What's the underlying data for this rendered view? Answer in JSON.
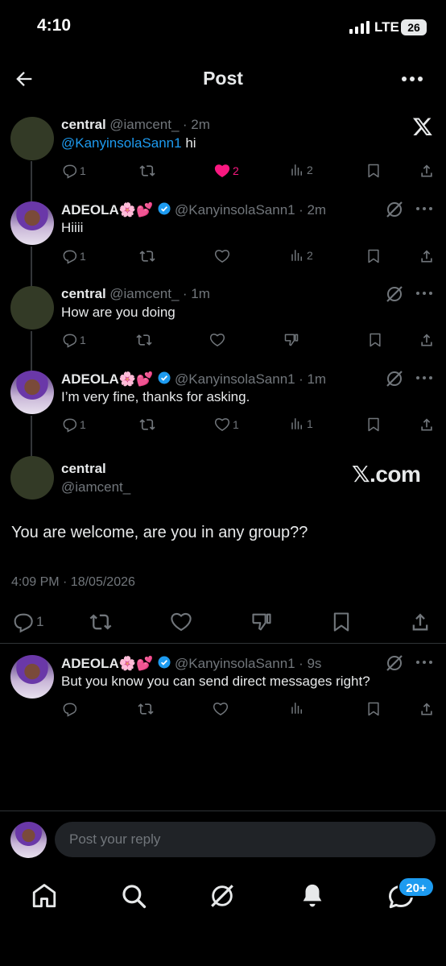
{
  "status_bar": {
    "time": "4:10",
    "network": "LTE",
    "battery": "26"
  },
  "header": {
    "title": "Post"
  },
  "posts": [
    {
      "name": "central",
      "handle": "@iamcent_",
      "time": "· 2m",
      "mention": "@KanyinsolaSann1",
      "text": " hi",
      "replies": "1",
      "likes": "2",
      "views": "2"
    },
    {
      "name": "ADEOLA🌸💕",
      "handle": "@KanyinsolaSann1",
      "time": "· 2m",
      "text": "Hiiii",
      "replies": "1",
      "views": "2"
    },
    {
      "name": "central",
      "handle": "@iamcent_",
      "time": "· 1m",
      "text": "How are you doing",
      "replies": "1"
    },
    {
      "name": "ADEOLA🌸💕",
      "handle": "@KanyinsolaSann1",
      "time": "· 1m",
      "text": "I’m very fine, thanks for asking.",
      "replies": "1",
      "likes": "1",
      "views": "1"
    }
  ],
  "main_post": {
    "name": "central",
    "handle": "@iamcent_",
    "watermark": "𝕏.com",
    "text": "You are welcome, are you in any group??",
    "timestamp": "4:09 PM · 18/05/2026",
    "replies": "1"
  },
  "reply_post": {
    "name": "ADEOLA🌸💕",
    "handle": "@KanyinsolaSann1",
    "time": "· 9s",
    "text": "But you know you can send direct messages right?"
  },
  "composer": {
    "placeholder": "Post your reply"
  },
  "bottom_nav": {
    "messages_badge": "20+"
  },
  "colors": {
    "accent": "#1d9bf0",
    "like": "#f91880",
    "muted": "#71767b"
  }
}
